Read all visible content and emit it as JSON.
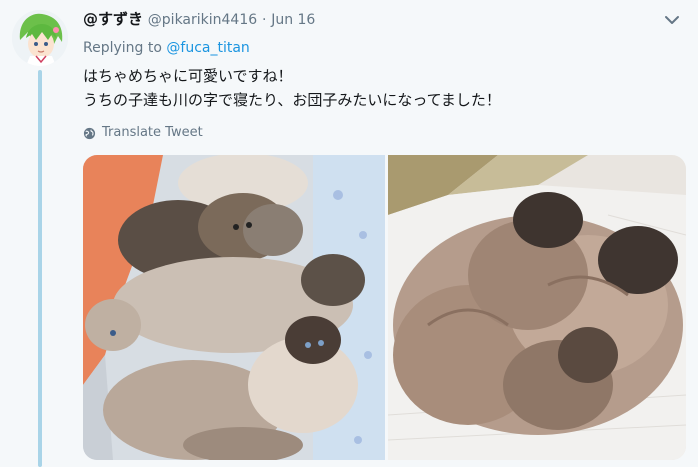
{
  "tweet": {
    "display_name": "@すずき",
    "handle": "@pikarikin4416",
    "separator": "·",
    "date": "Jun 16",
    "replying_prefix": "Replying to",
    "replying_handle": "@fuca_titan",
    "text_lines": [
      "はちゃめちゃに可愛いですね！",
      "うちの子達も川の字で寝たり、お団子みたいになってました！"
    ],
    "translate_label": "Translate Tweet"
  },
  "icons": {
    "caret": "chevron-down-icon",
    "translate": "globe-icon",
    "avatar": "avatar"
  },
  "colors": {
    "background": "#f5f8fa",
    "link": "#1b95e0",
    "muted": "#657786",
    "thread_line": "#a9d4e8"
  }
}
